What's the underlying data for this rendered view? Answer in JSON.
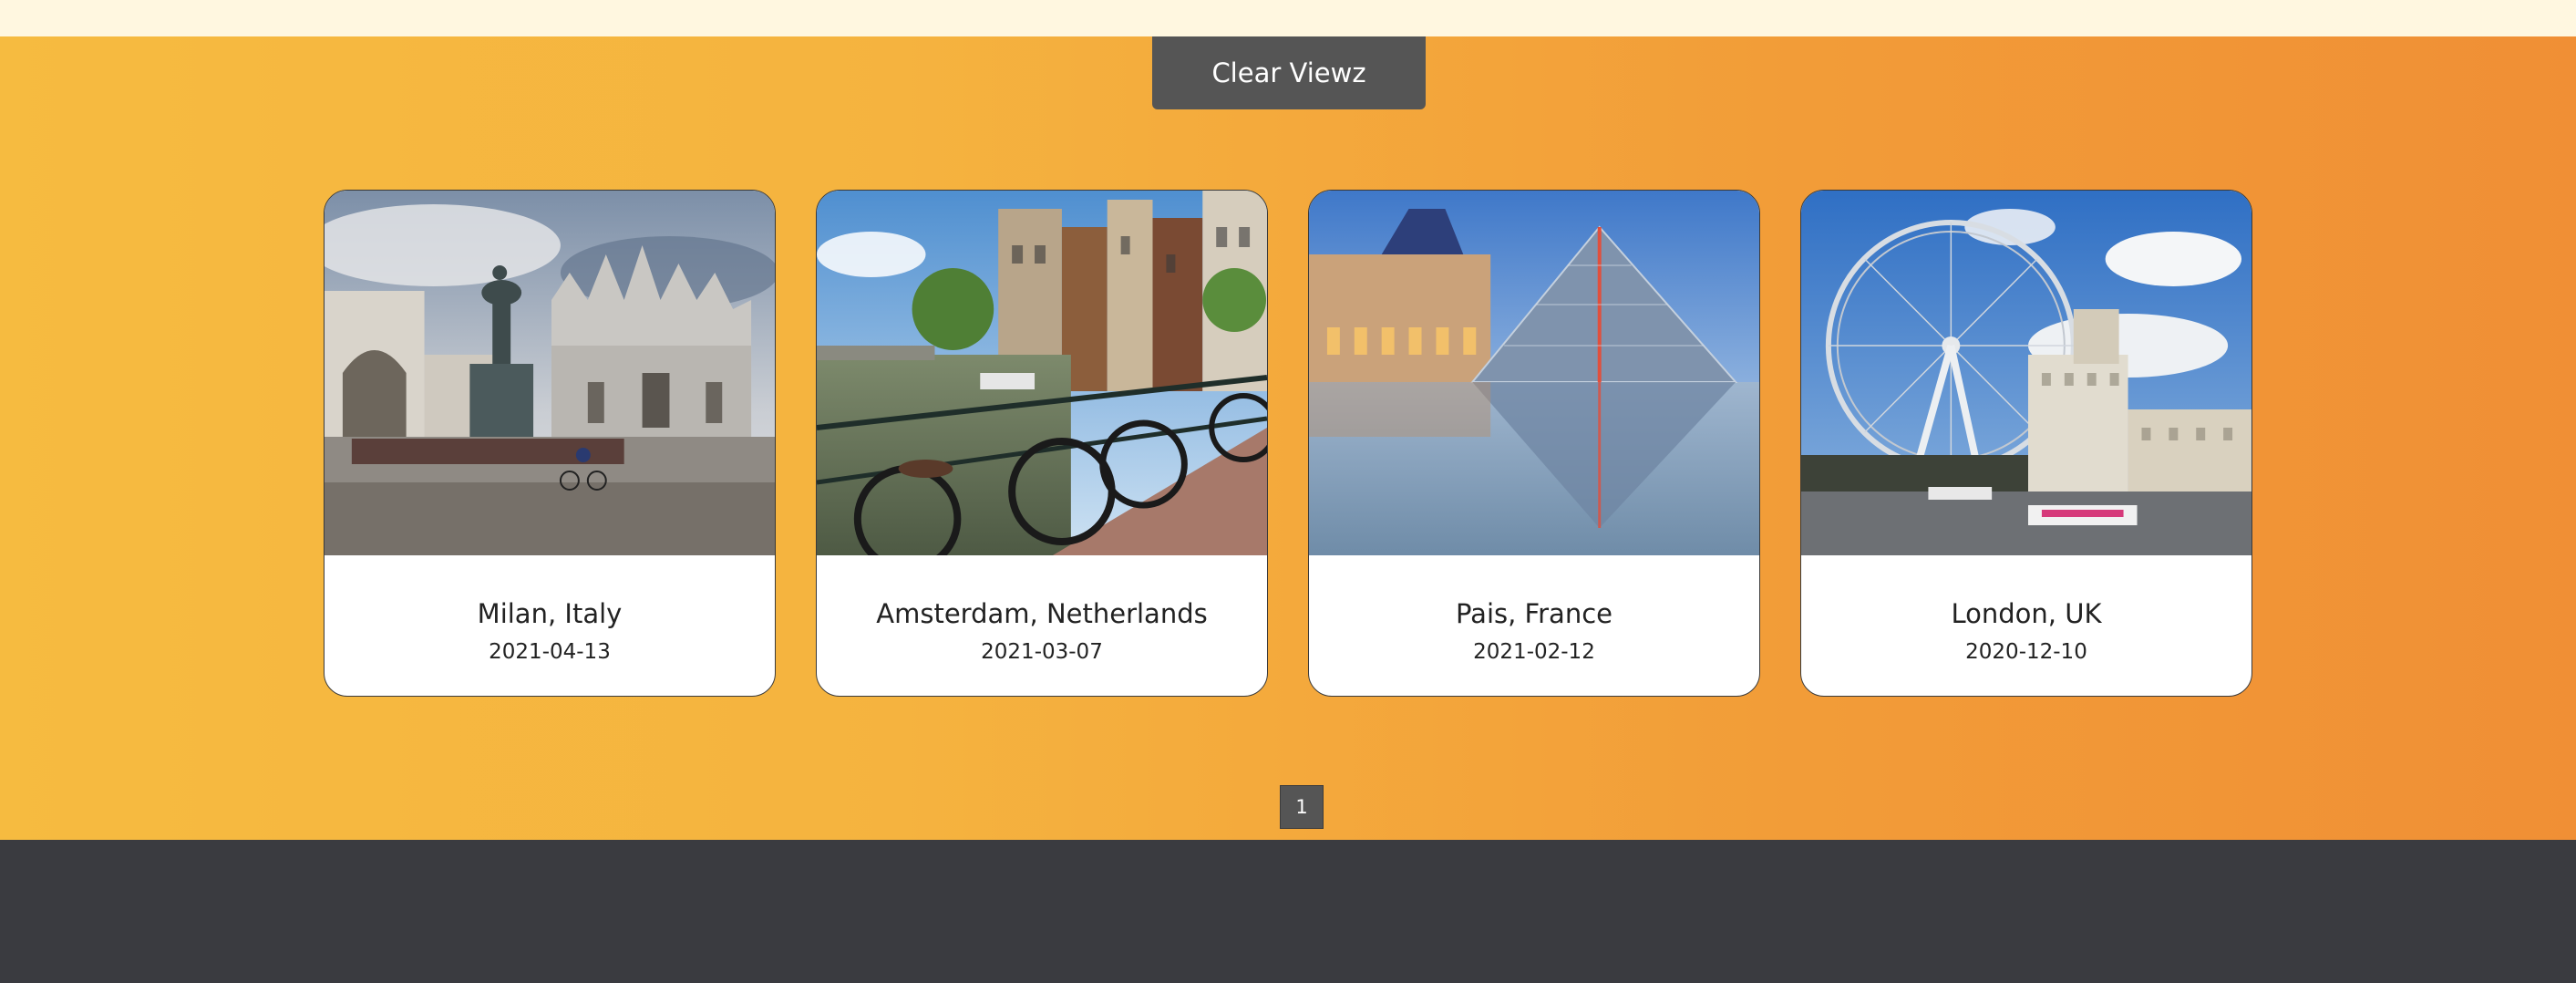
{
  "toolbar": {
    "clear_label": "Clear Viewz"
  },
  "cards": [
    {
      "title": "Milan, Italy",
      "date": "2021-04-13",
      "image": "milan-cathedral-photo"
    },
    {
      "title": "Amsterdam, Netherlands",
      "date": "2021-03-07",
      "image": "amsterdam-canal-photo"
    },
    {
      "title": "Pais, France",
      "date": "2021-02-12",
      "image": "louvre-pyramid-photo"
    },
    {
      "title": "London, UK",
      "date": "2020-12-10",
      "image": "london-eye-photo"
    }
  ],
  "pagination": {
    "pages": [
      "1"
    ],
    "current": "1"
  },
  "colors": {
    "topbar": "#fff7e0",
    "gradient_start": "#f6bb40",
    "gradient_end": "#f08f35",
    "button": "#555555",
    "footer": "#3a3b40"
  }
}
